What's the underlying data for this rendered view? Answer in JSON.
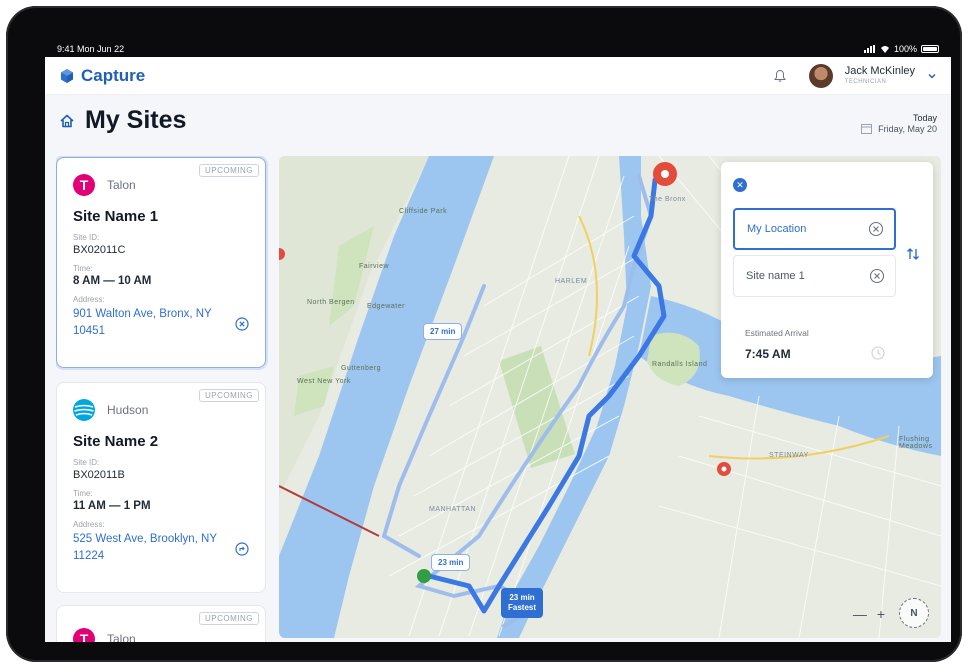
{
  "status_bar": {
    "time": "9:41",
    "date": "Mon Jun 22",
    "battery": "100%"
  },
  "app": {
    "name": "Capture"
  },
  "user": {
    "name": "Jack McKinley",
    "role": "TECHNICIAN"
  },
  "page": {
    "title": "My Sites"
  },
  "date": {
    "label": "Today",
    "value": "Friday, May 20"
  },
  "labels": {
    "site_id": "Site ID:",
    "time": "Time:",
    "address": "Address:"
  },
  "sites": [
    {
      "status": "UPCOMING",
      "carrier": "Talon",
      "logo": "T",
      "name": "Site Name 1",
      "site_id": "BX02011C",
      "time": "8 AM — 10 AM",
      "address": "901 Walton Ave, Bronx, NY 10451",
      "action_icon": "close-circle-icon"
    },
    {
      "status": "UPCOMING",
      "carrier": "Hudson",
      "logo": "",
      "name": "Site Name 2",
      "site_id": "BX02011B",
      "time": "11 AM — 1 PM",
      "address": "525 West Ave, Brooklyn, NY 11224",
      "action_icon": "directions-icon"
    },
    {
      "status": "UPCOMING",
      "carrier": "Talon",
      "logo": "T"
    }
  ],
  "map": {
    "route_times": {
      "alt_1": "27 min",
      "alt_2": "23 min",
      "fastest": "23 min",
      "fastest_label": "Fastest"
    },
    "labels": [
      "Cliffside Park",
      "Fairview",
      "North Bergen",
      "Edgewater",
      "West New York",
      "Guttenberg",
      "HARLEM",
      "Randalls Island",
      "MANHATTAN",
      "The Bronx",
      "STEINWAY",
      "Flushing Meadows"
    ],
    "zoom_out": "—",
    "zoom_in": "+",
    "compass": "N"
  },
  "directions": {
    "from": "My Location",
    "to": "Site name 1",
    "eta_label": "Estimated Arrival",
    "eta_value": "7:45 AM"
  },
  "colors": {
    "brand": "#1f5fb8",
    "link": "#2f6fd1",
    "route": "#4a86e8",
    "t_mobile": "#e20074",
    "att": "#00a8e0",
    "water": "#9cc6f0"
  }
}
